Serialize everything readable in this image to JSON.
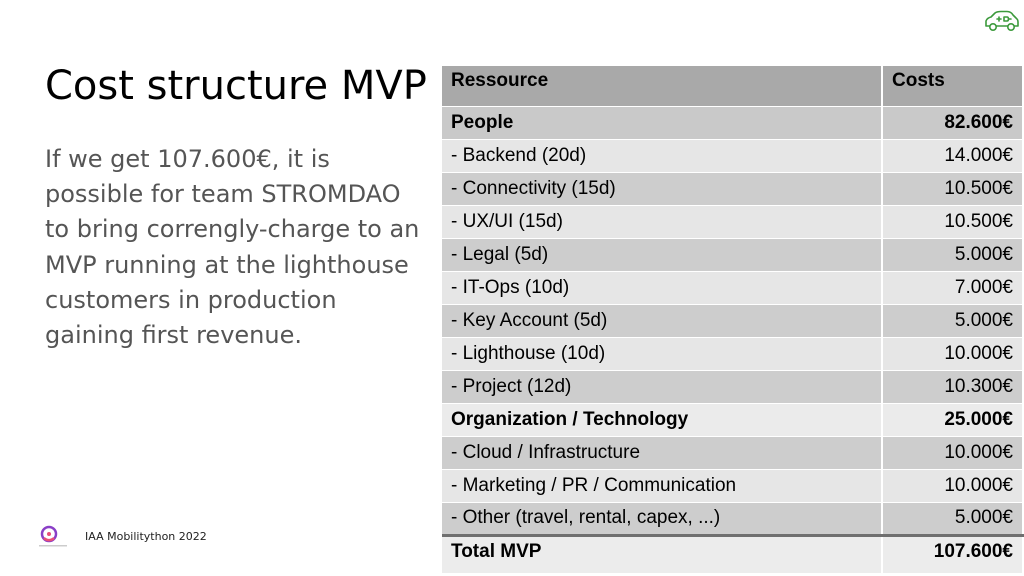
{
  "slide": {
    "title": "Cost structure MVP",
    "body": "If we get 107.600€, it is possible for team STROMDAO to bring correngly-charge to an MVP running at the lighthouse customers in production gaining first revenue.",
    "footer": "IAA Mobilitython 2022"
  },
  "icons": {
    "top_right": "electric-car-icon",
    "bottom_left": "corrently-logo"
  },
  "colors": {
    "header": "#a9a9a9",
    "row_dark": "#cdcdcd",
    "row_light": "#e6e6e6",
    "car_icon": "#3c9a3c"
  },
  "table": {
    "headers": [
      "Ressource",
      "Costs"
    ],
    "rows": [
      {
        "label": "People",
        "cost": "82.600€",
        "bold": true
      },
      {
        "label": "- Backend (20d)",
        "cost": "14.000€"
      },
      {
        "label": "- Connectivity (15d)",
        "cost": "10.500€"
      },
      {
        "label": "- UX/UI (15d)",
        "cost": "10.500€"
      },
      {
        "label": "- Legal (5d)",
        "cost": "5.000€"
      },
      {
        "label": "- IT-Ops (10d)",
        "cost": "7.000€"
      },
      {
        "label": "- Key Account  (5d)",
        "cost": "5.000€"
      },
      {
        "label": "- Lighthouse (10d)",
        "cost": "10.000€"
      },
      {
        "label": "- Project (12d)",
        "cost": "10.300€"
      },
      {
        "label": "Organization / Technology",
        "cost": "25.000€",
        "bold": true
      },
      {
        "label": "- Cloud / Infrastructure",
        "cost": "10.000€"
      },
      {
        "label": "- Marketing / PR / Communication",
        "cost": "10.000€"
      },
      {
        "label": "- Other (travel, rental, capex, ...)",
        "cost": "5.000€"
      }
    ],
    "total": {
      "label": "Total MVP",
      "cost": "107.600€"
    }
  }
}
